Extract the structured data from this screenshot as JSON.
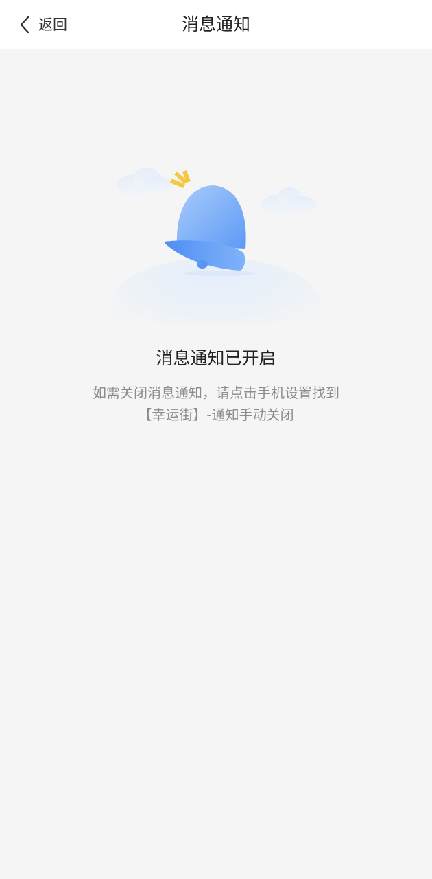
{
  "header": {
    "back_label": "返回",
    "title": "消息通知"
  },
  "icons": {
    "back": "chevron-left-icon",
    "illustration": "bell-illustration"
  },
  "colors": {
    "header_bg": "#ffffff",
    "page_bg": "#f5f5f5",
    "bell_blue": "#6aa7f8",
    "accent_yellow": "#f5c842"
  },
  "status": {
    "title": "消息通知已开启",
    "description_line1": "如需关闭消息通知，请点击手机设置找到",
    "description_line2": "【幸运街】-通知手动关闭"
  }
}
